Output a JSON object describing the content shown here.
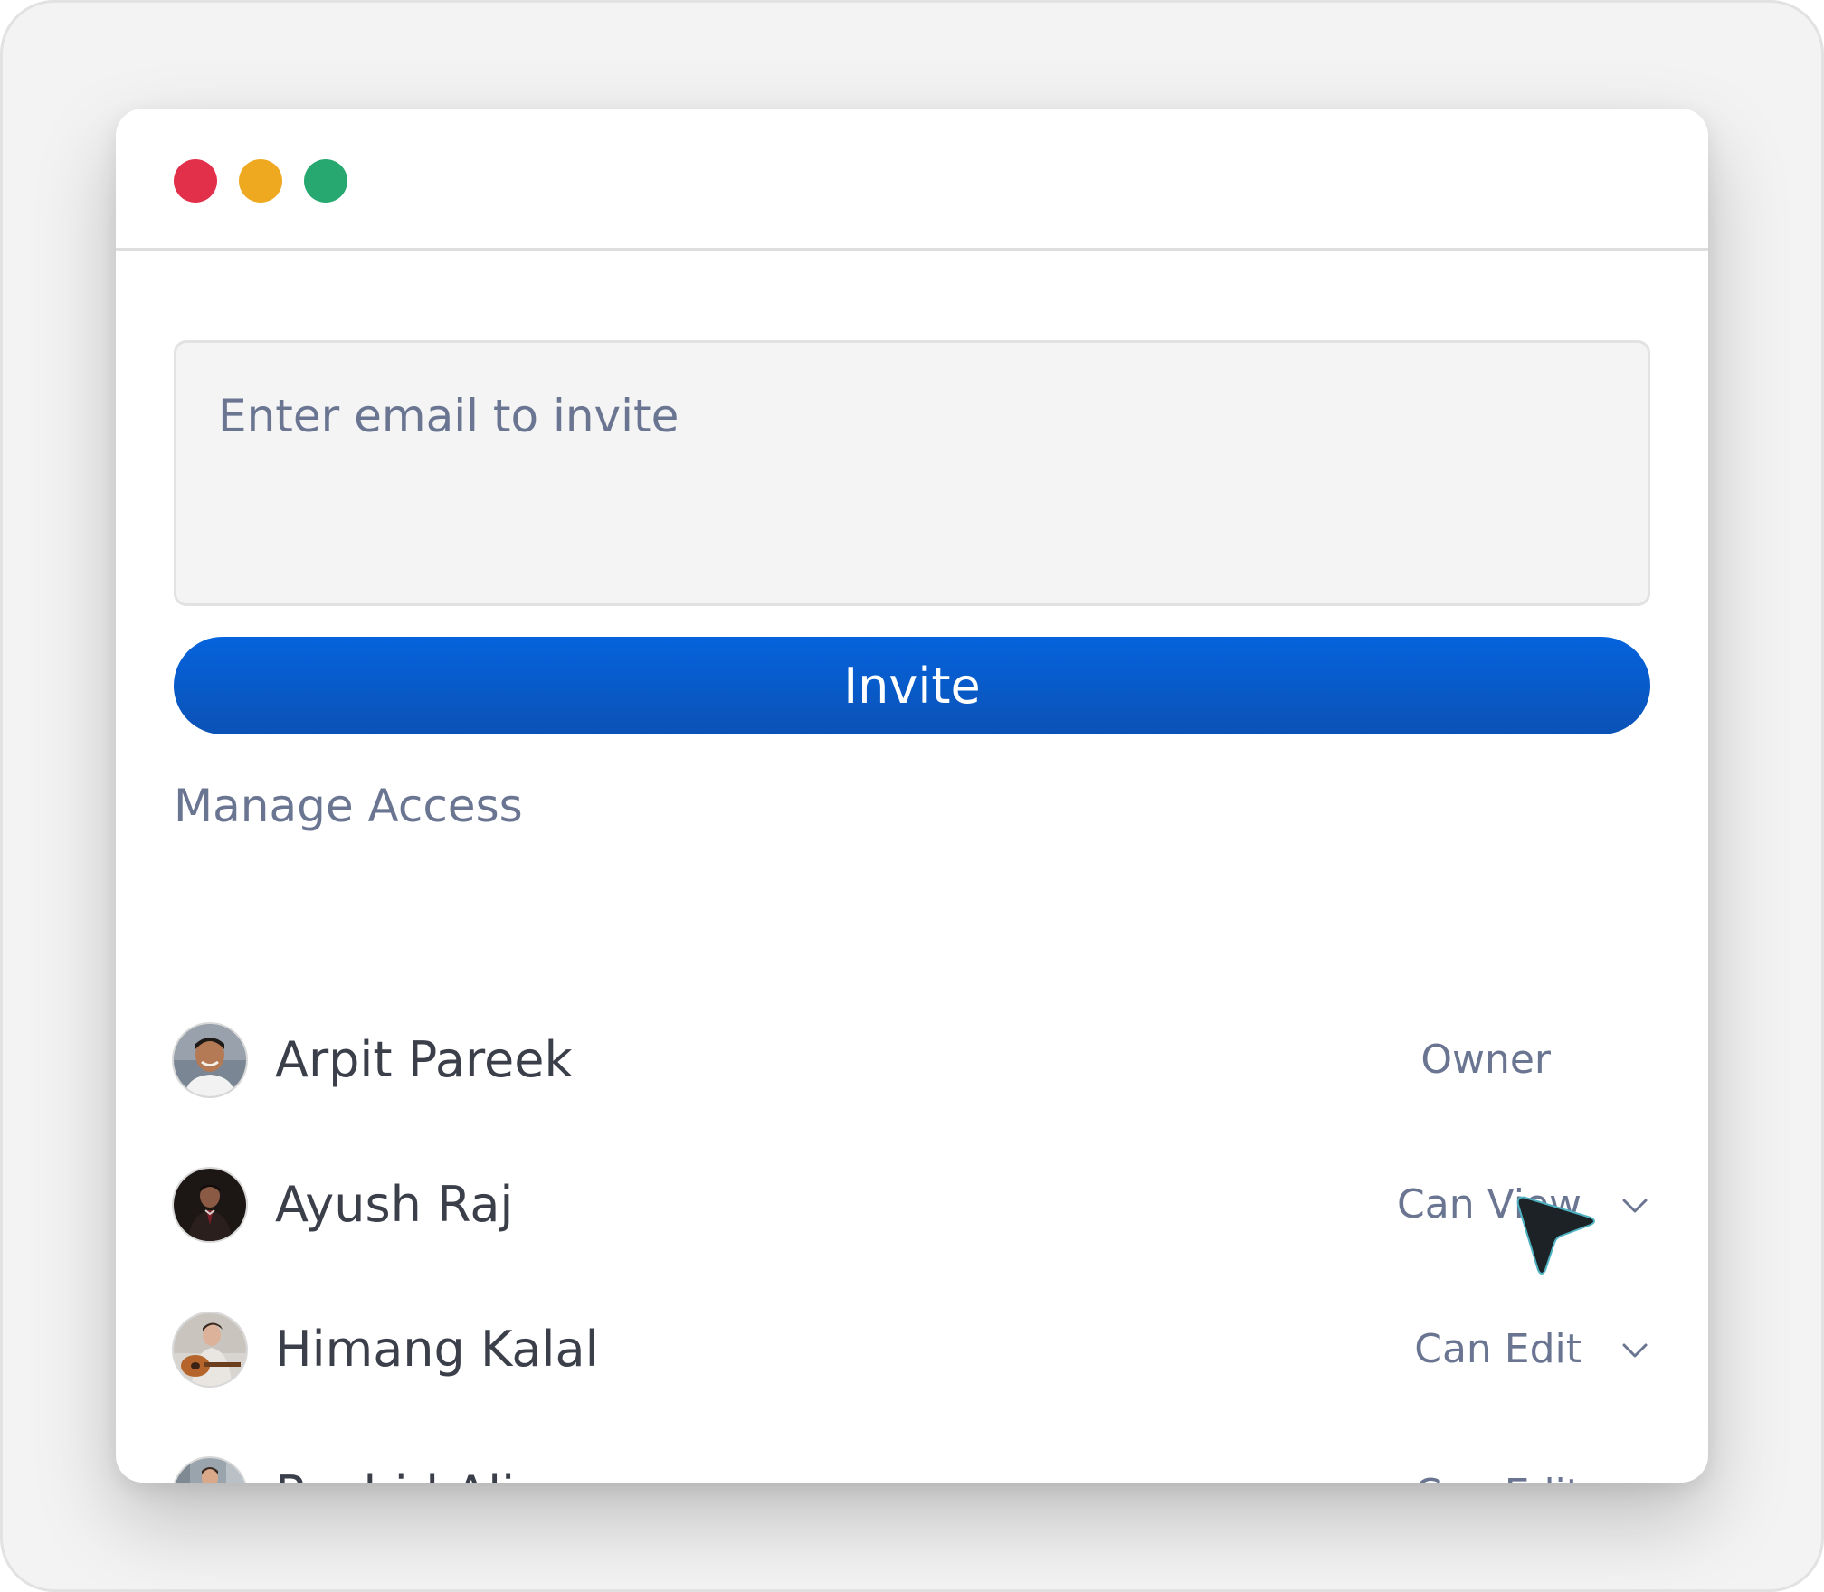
{
  "window": {
    "controls": [
      "close",
      "minimize",
      "maximize"
    ],
    "colors": {
      "close": "#e3304a",
      "minimize": "#eea920",
      "maximize": "#27a870"
    }
  },
  "invite": {
    "placeholder": "Enter email to invite",
    "value": "",
    "button_label": "Invite",
    "button_color": "#0563dc"
  },
  "manage_access": {
    "title": "Manage Access",
    "members": [
      {
        "name": "Arpit Pareek",
        "role": "Owner",
        "editable": false
      },
      {
        "name": "Ayush Raj",
        "role": "Can View",
        "editable": true
      },
      {
        "name": "Himang Kalal",
        "role": "Can Edit",
        "editable": true
      },
      {
        "name": "Rashid Ali",
        "role": "Can Edit",
        "editable": true
      }
    ]
  },
  "icons": {
    "role_dropdown": "chevron-down-icon",
    "cursor": "mouse-pointer-icon"
  }
}
